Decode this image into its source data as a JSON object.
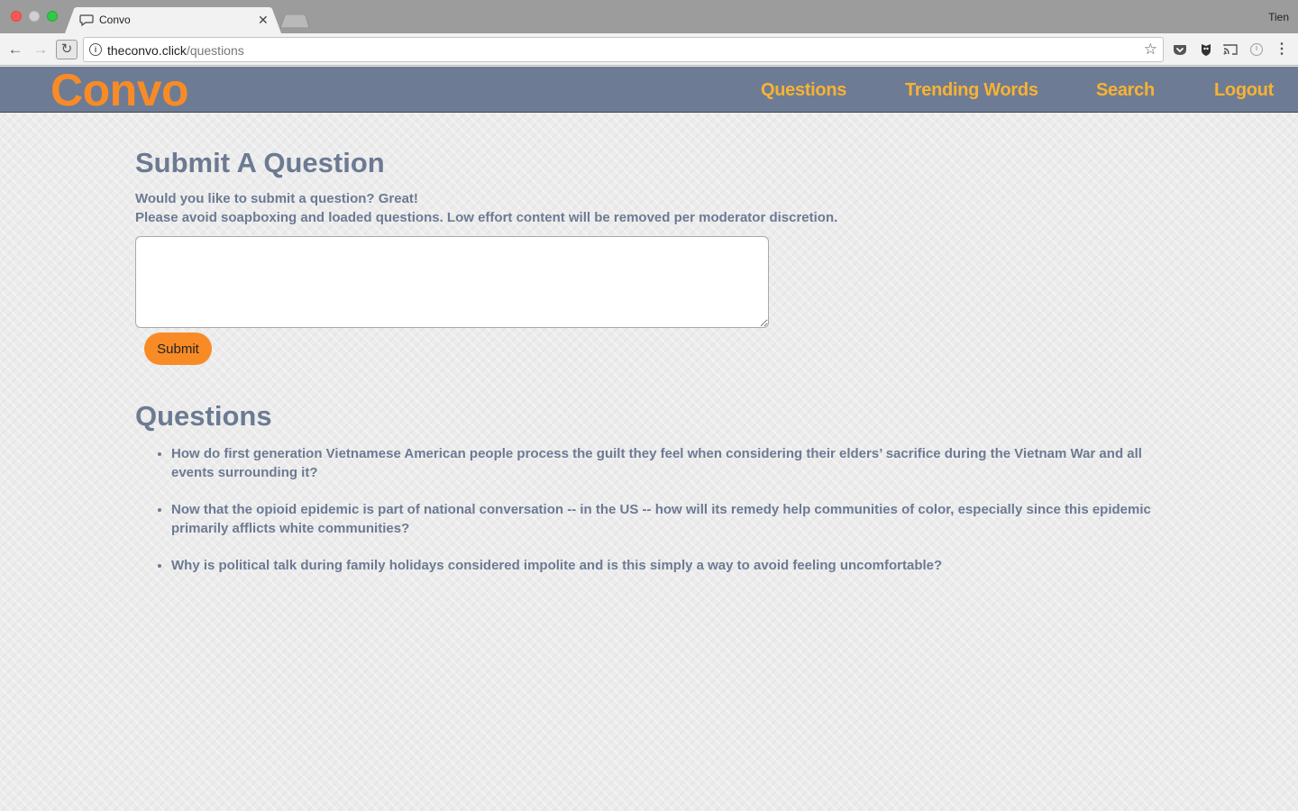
{
  "browser": {
    "tab_title": "Convo",
    "profile_name": "Tien",
    "url_host": "theconvo.click",
    "url_path": "/questions"
  },
  "nav": {
    "brand": "Convo",
    "links": [
      "Questions",
      "Trending Words",
      "Search",
      "Logout"
    ]
  },
  "submit_section": {
    "heading": "Submit A Question",
    "intro_line1": "Would you like to submit a question? Great!",
    "intro_line2": "Please avoid soapboxing and loaded questions. Low effort content will be removed per moderator discretion.",
    "textarea_value": "",
    "submit_label": "Submit"
  },
  "questions_section": {
    "heading": "Questions",
    "items": [
      "How do first generation Vietnamese American people process the guilt they feel when considering their elders’ sacrifice during the Vietnam War and all events surrounding it?",
      "Now that the opioid epidemic is part of national conversation -- in the US -- how will its remedy help communities of color, especially since this epidemic primarily afflicts white communities?",
      "Why is political talk during family holidays considered impolite and is this simply a way to avoid feeling uncomfortable?"
    ]
  },
  "colors": {
    "brand": "#f98b27",
    "nav_link": "#f9b233",
    "navbar_bg": "#6d7c94",
    "text": "#6c7a92",
    "button": "#f98b27"
  }
}
